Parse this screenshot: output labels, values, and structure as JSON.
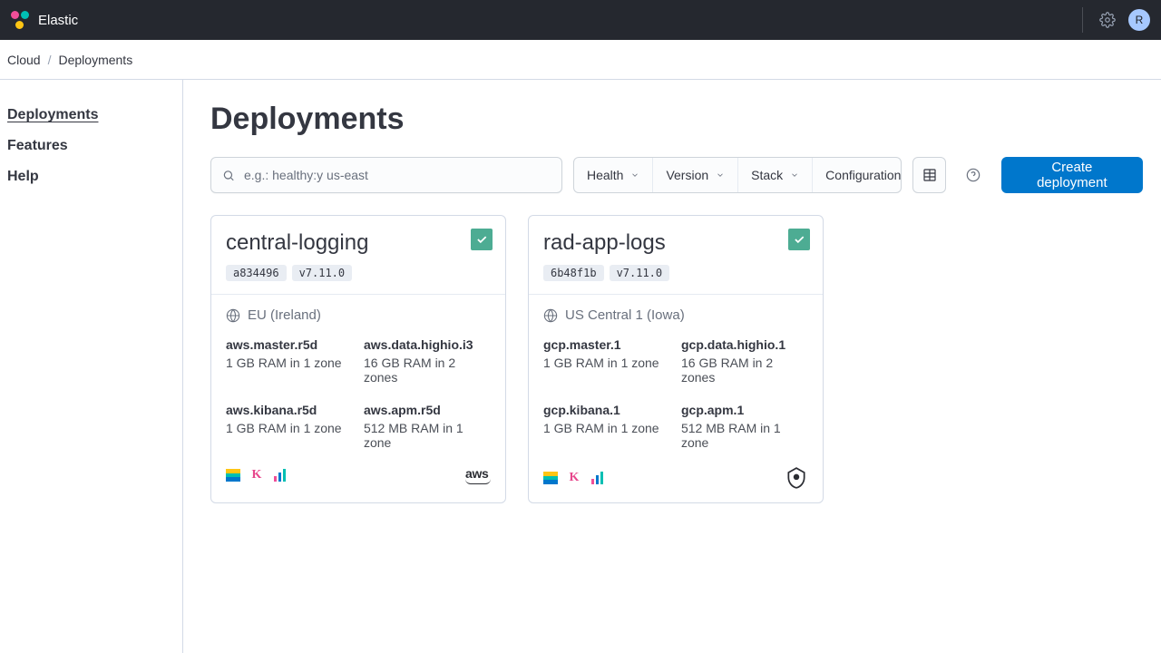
{
  "brand": "Elastic",
  "avatar_initial": "R",
  "breadcrumb": {
    "root": "Cloud",
    "current": "Deployments"
  },
  "sidebar": [
    {
      "label": "Deployments",
      "active": true
    },
    {
      "label": "Features",
      "active": false
    },
    {
      "label": "Help",
      "active": false
    }
  ],
  "page_title": "Deployments",
  "search": {
    "placeholder": "e.g.: healthy:y us-east"
  },
  "filters": [
    {
      "label": "Health"
    },
    {
      "label": "Version"
    },
    {
      "label": "Stack"
    },
    {
      "label": "Configuration"
    }
  ],
  "create_button": "Create deployment",
  "deployments": [
    {
      "name": "central-logging",
      "id": "a834496",
      "version": "v7.11.0",
      "region": "EU (Ireland)",
      "provider": "aws",
      "specs": [
        {
          "name": "aws.master.r5d",
          "detail": "1 GB RAM in 1 zone"
        },
        {
          "name": "aws.data.highio.i3",
          "detail": "16 GB RAM in 2 zones"
        },
        {
          "name": "aws.kibana.r5d",
          "detail": "1 GB RAM in 1 zone"
        },
        {
          "name": "aws.apm.r5d",
          "detail": "512 MB RAM in 1 zone"
        }
      ]
    },
    {
      "name": "rad-app-logs",
      "id": "6b48f1b",
      "version": "v7.11.0",
      "region": "US Central 1 (Iowa)",
      "provider": "gcp",
      "specs": [
        {
          "name": "gcp.master.1",
          "detail": "1 GB RAM in 1 zone"
        },
        {
          "name": "gcp.data.highio.1",
          "detail": "16 GB RAM in 2 zones"
        },
        {
          "name": "gcp.kibana.1",
          "detail": "1 GB RAM in 1 zone"
        },
        {
          "name": "gcp.apm.1",
          "detail": "512 MB RAM in 1 zone"
        }
      ]
    }
  ]
}
